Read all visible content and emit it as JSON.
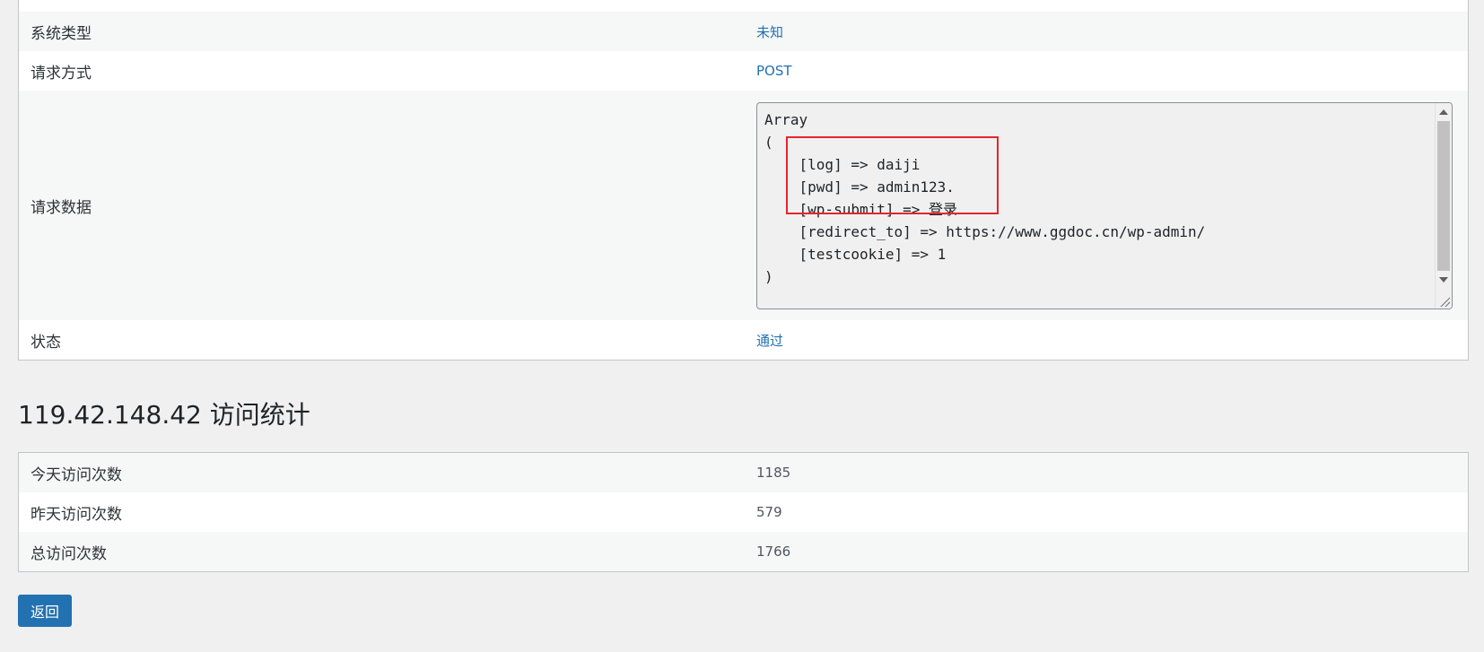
{
  "details": {
    "system_type": {
      "label": "系统类型",
      "value": "未知"
    },
    "request_method": {
      "label": "请求方式",
      "value": "POST"
    },
    "request_data": {
      "label": "请求数据",
      "value": "Array\n(\n    [log] => daiji\n    [pwd] => admin123.\n    [wp-submit] => 登录\n    [redirect_to] => https://www.ggdoc.cn/wp-admin/\n    [testcookie] => 1\n)"
    },
    "status": {
      "label": "状态",
      "value": "通过"
    }
  },
  "stats": {
    "heading": "119.42.148.42 访问统计",
    "rows": [
      {
        "label": "今天访问次数",
        "value": "1185"
      },
      {
        "label": "昨天访问次数",
        "value": "579"
      },
      {
        "label": "总访问次数",
        "value": "1766"
      }
    ]
  },
  "back_button": {
    "label": "返回"
  },
  "colors": {
    "link": "#2271b1",
    "highlight_border": "#e5252a",
    "button_bg": "#2271b1",
    "page_bg": "#f0f0f1"
  }
}
